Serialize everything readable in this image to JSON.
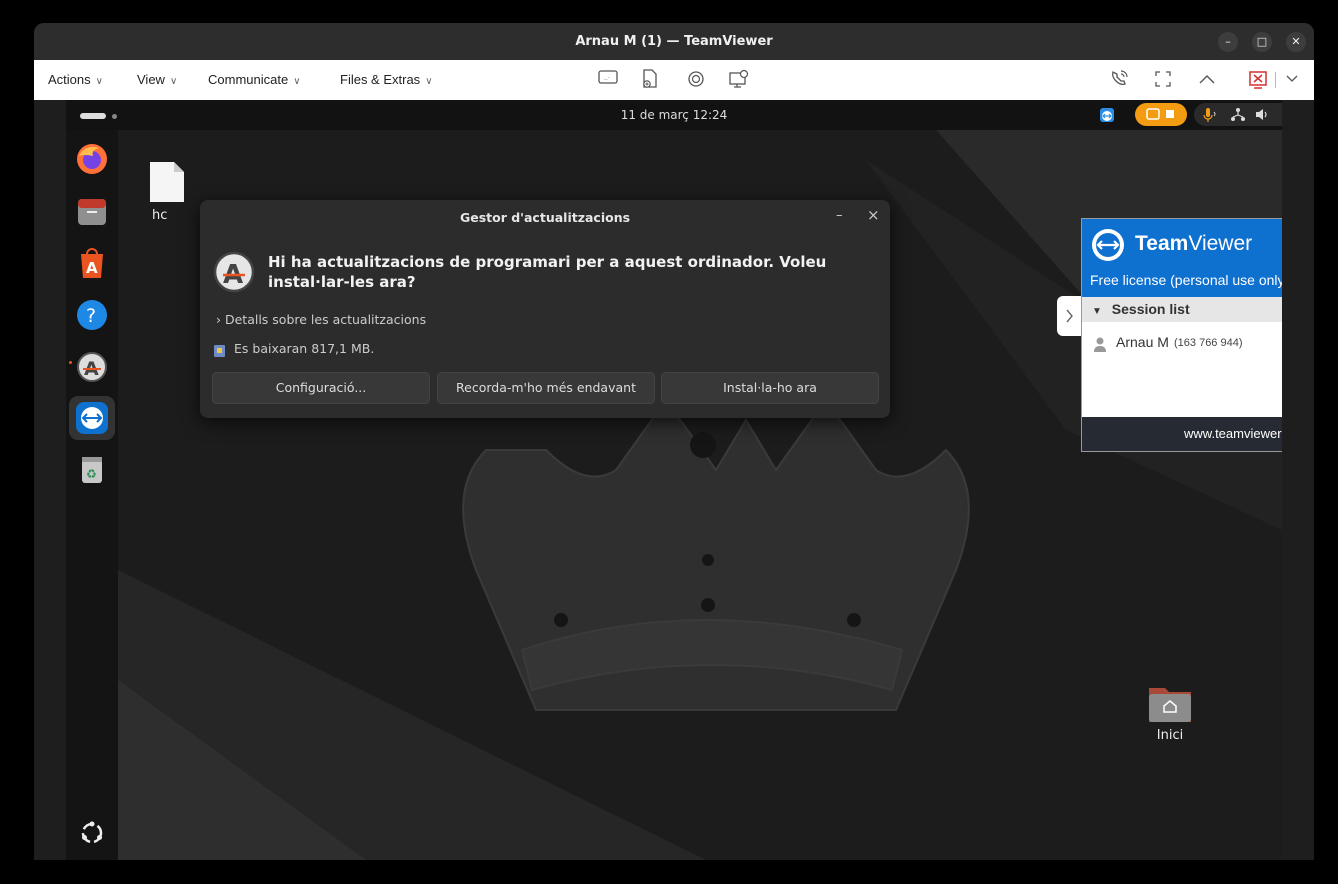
{
  "window": {
    "title": "Arnau M (1) — TeamViewer",
    "controls": [
      "minimize",
      "maximize",
      "close"
    ]
  },
  "toolbar": {
    "menus": [
      {
        "label": "Actions"
      },
      {
        "label": "View"
      },
      {
        "label": "Communicate"
      },
      {
        "label": "Files & Extras"
      }
    ]
  },
  "remote": {
    "clock": "11 de març  12:24",
    "desktop_icons": {
      "file_label": "hc",
      "home_label": "Inici"
    }
  },
  "dialog": {
    "title": "Gestor d'actualitzacions",
    "minimize_label": "–",
    "close_label": "×",
    "heading": "Hi ha actualitzacions de programari per a aquest ordinador. Voleu instal·lar-les ara?",
    "details_label": "Detalls sobre les actualitzacions",
    "download_size": "Es baixaran 817,1 MB.",
    "buttons": {
      "settings": "Configuració...",
      "remind": "Recorda-m'ho més endavant",
      "install": "Instal·la-ho ara"
    }
  },
  "tv_panel": {
    "brand_bold": "Team",
    "brand_light": "Viewer",
    "close_label": "×",
    "license": "Free license (personal use only)",
    "session_header": "Session list",
    "session_user": "Arnau M",
    "session_id": "(163 766 944)",
    "footer_url": "www.teamviewer.com"
  },
  "colors": {
    "teamviewer_blue": "#0e70cf",
    "ubuntu_orange": "#e95420",
    "record_orange": "#f39c12"
  }
}
